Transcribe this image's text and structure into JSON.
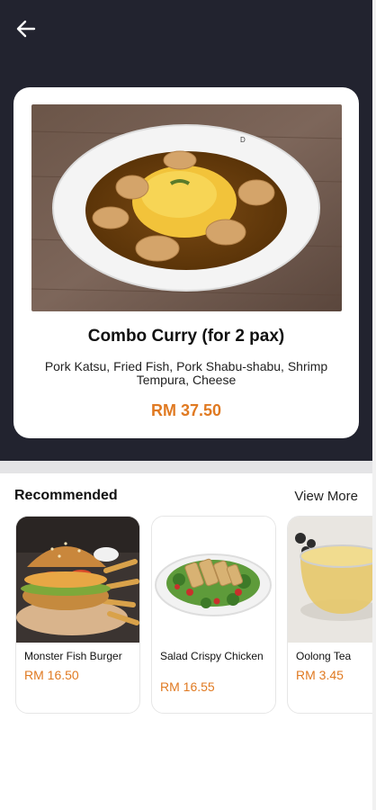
{
  "header": {
    "back_icon": "arrow-left-icon",
    "background_color": "#22232f"
  },
  "product": {
    "image": "curry-plate-image",
    "name": "Combo Curry (for 2 pax)",
    "description": "Pork Katsu, Fried Fish, Pork Shabu-shabu, Shrimp Tempura, Cheese",
    "price": "RM 37.50"
  },
  "recommended": {
    "title": "Recommended",
    "view_more": "View More",
    "items": [
      {
        "name": "Monster Fish Burger",
        "price": "RM 16.50",
        "image": "fish-burger-image"
      },
      {
        "name": "Salad Crispy Chicken",
        "price": "RM 16.55",
        "image": "chicken-salad-image"
      },
      {
        "name": "Oolong Tea",
        "price": "RM 3.45",
        "image": "oolong-tea-image"
      }
    ]
  },
  "colors": {
    "accent": "#e07a22",
    "dark_bg": "#22232f",
    "divider": "#e4e4e6"
  }
}
